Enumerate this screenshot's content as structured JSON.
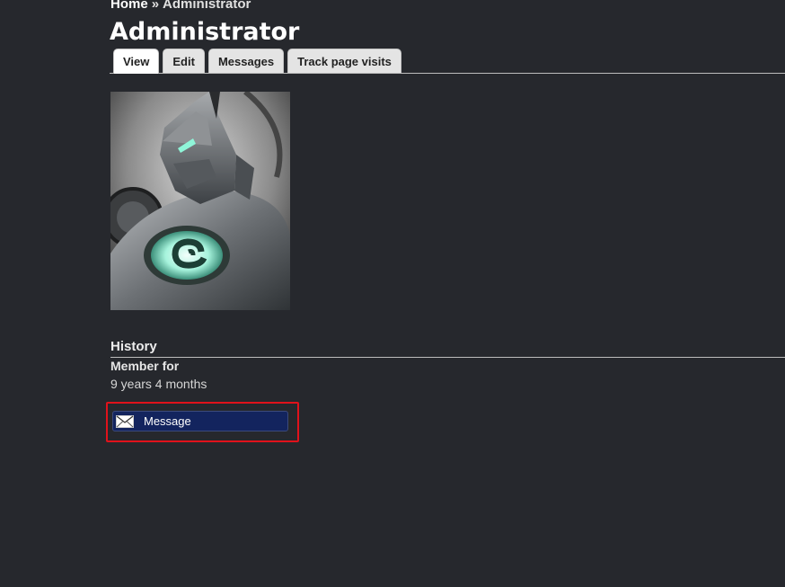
{
  "breadcrumb": {
    "home": "Home",
    "separator": "»",
    "current": "Administrator"
  },
  "page": {
    "title": "Administrator"
  },
  "tabs": [
    {
      "label": "View",
      "active": true
    },
    {
      "label": "Edit",
      "active": false
    },
    {
      "label": "Messages",
      "active": false
    },
    {
      "label": "Track page visits",
      "active": false
    }
  ],
  "profile": {
    "history_title": "History",
    "member_for_label": "Member for",
    "member_for_value": "9 years 4 months",
    "message_button_label": "Message",
    "message_icon": "envelope-icon"
  },
  "colors": {
    "background": "#26282d",
    "button": "#13245e",
    "highlight": "#e0121b",
    "avatar_glow": "#9cf0d8"
  }
}
